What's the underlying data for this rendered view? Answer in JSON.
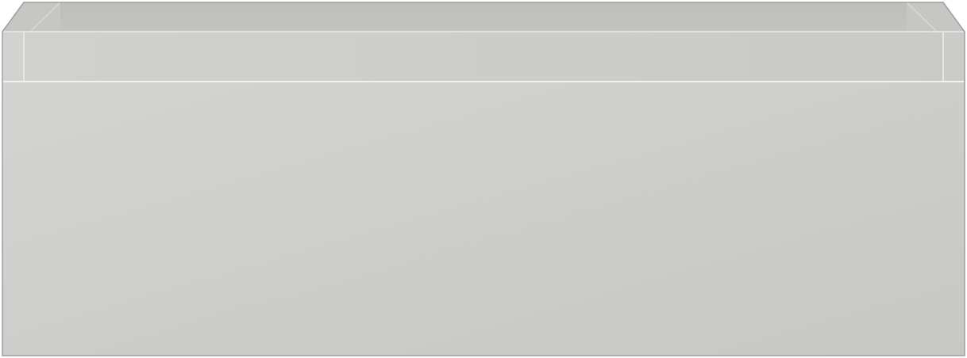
{
  "object": {
    "icon": "drawer-box-icon",
    "colors": {
      "front_light": "#d3d3d1",
      "front_dark": "#c7c7c5",
      "rim_light": "#d0d0ce",
      "rim_dark": "#c9c9c7",
      "inner_back": "#bcbcbb",
      "inner_side": "#c6c6c4",
      "top_edge": "#e2e2e0",
      "seam": "#f1f1ef",
      "outline": "#9f9f9d"
    }
  }
}
